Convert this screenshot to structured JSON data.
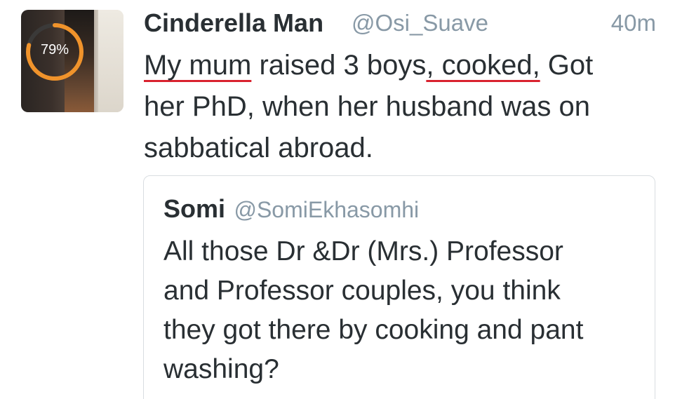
{
  "tweet": {
    "avatar_icon": "profile-photo",
    "progress_label": "79%",
    "progress_value": 0.79,
    "display_name": "Cinderella Man",
    "username": "@Osi_Suave",
    "timestamp": "40m",
    "text_lines": [
      [
        "",
        "My mum",
        " raised 3 boys",
        ", cooked,",
        " Got"
      ],
      "her PhD, when her husband was on",
      "sabbatical abroad."
    ],
    "underline_color": "#d9232f"
  },
  "quoted_tweet": {
    "display_name": "Somi",
    "username": "@SomiEkhasomhi",
    "text_lines": [
      "All those Dr &Dr (Mrs.) Professor",
      "and Professor couples, you think",
      "they got there by cooking and pant",
      "washing?"
    ]
  }
}
